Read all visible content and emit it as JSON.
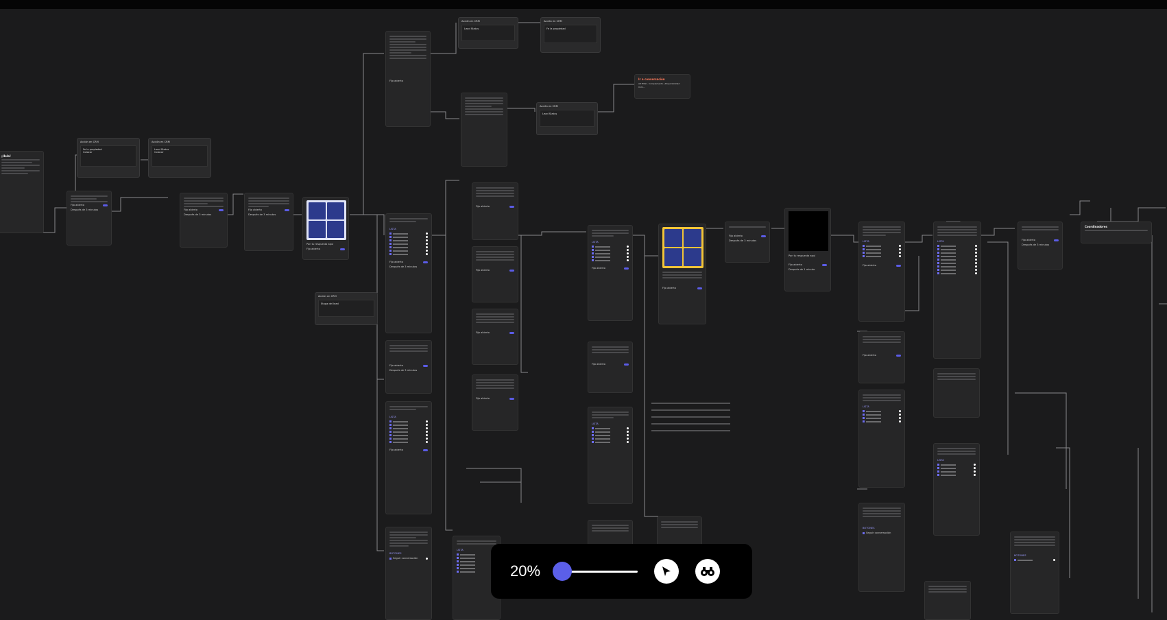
{
  "controls": {
    "zoom_label": "20%",
    "zoom_value_percent": 20,
    "pointer_tool_icon": "cursor-arrow-icon",
    "search_tool_icon": "binoculars-icon"
  },
  "crm_actions": {
    "title": "Acción en CRM",
    "set_property": "Fe la propiedad",
    "property_lead_status": "Lead Status",
    "property_stage": "Etapa del lead",
    "collect": "Colocar"
  },
  "common": {
    "fixed_label": "Fijo abierto",
    "wait_label": "Después de 3 minutos",
    "wait_1min": "Después de 1 minuto",
    "list_label": "LISTA",
    "buttons_label": "BOTONES",
    "follow_conversation": "Seguir conversación",
    "reply_placeholder": "Pon tu respuesta aquí",
    "conversation_title": "Ir a conversación",
    "conversation_item": "AD BSSI - Complemento | Disponibilidad Imm...",
    "coordinates_title": "Coordinadores"
  }
}
